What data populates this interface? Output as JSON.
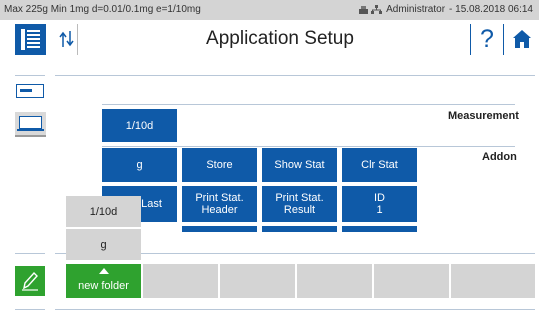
{
  "status_bar": {
    "info": "Max 225g  Min 1mg  d=0.01/0.1mg  e=1/10mg",
    "user": "Administrator",
    "date_time": "-  15.08.2018 06:14"
  },
  "header": {
    "title": "Application Setup",
    "help_label": "?"
  },
  "sections": {
    "measurement": "Measurement",
    "addon": "Addon"
  },
  "measurement_tiles": [
    "1/10d"
  ],
  "addon_row1": [
    "g",
    "Store",
    "Show Stat",
    "Clr Stat"
  ],
  "addon_row2": [
    {
      "line1": "Last",
      "line2": ""
    },
    {
      "line1": "Print Stat.",
      "line2": "Header"
    },
    {
      "line1": "Print Stat.",
      "line2": "Result"
    },
    {
      "line1": "ID",
      "line2": "1"
    }
  ],
  "popup": [
    "1/10d",
    "g"
  ],
  "bottom": {
    "folder_label": "new folder"
  },
  "colors": {
    "accent_blue": "#0f5aa8",
    "accent_green": "#2fa22f",
    "status_gray": "#d4d4d4"
  },
  "icons": {
    "menu": "list-menu-icon",
    "updown": "up-down-arrows-icon",
    "home": "home-icon",
    "edit": "pencil-icon"
  }
}
